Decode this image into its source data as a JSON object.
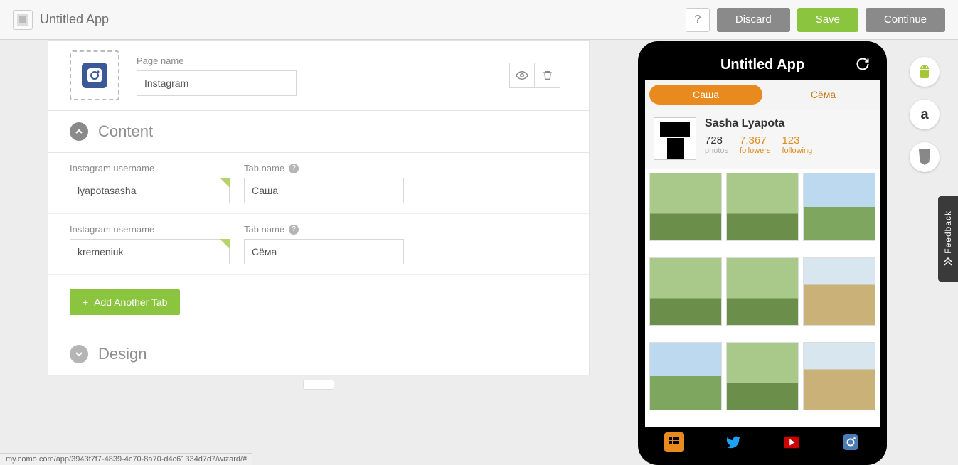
{
  "header": {
    "app_title": "Untitled App",
    "help": "?",
    "discard": "Discard",
    "save": "Save",
    "continue": "Continue"
  },
  "page": {
    "label_page_name": "Page name",
    "page_name_value": "Instagram"
  },
  "sections": {
    "content_title": "Content",
    "design_title": "Design"
  },
  "content": {
    "label_username": "Instagram username",
    "label_tabname": "Tab name",
    "rows": [
      {
        "username": "lyapotasasha",
        "tabname": "Саша"
      },
      {
        "username": "kremeniuk",
        "tabname": "Сёма"
      }
    ],
    "add_tab": "Add Another Tab"
  },
  "preview": {
    "title": "Untitled App",
    "tabs": [
      "Саша",
      "Сёма"
    ],
    "profile_name": "Sasha Lyapota",
    "stats": {
      "photos": {
        "num": "728",
        "label": "photos"
      },
      "followers": {
        "num": "7,367",
        "label": "followers"
      },
      "following": {
        "num": "123",
        "label": "following"
      }
    }
  },
  "status_url": "my.como.com/app/3943f7f7-4839-4c70-8a70-d4c61334d7d7/wizard/#",
  "feedback": "Feedback"
}
